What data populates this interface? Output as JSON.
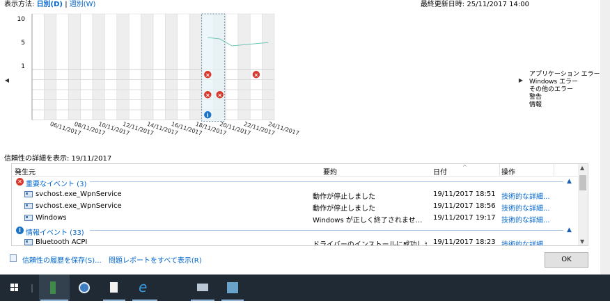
{
  "view": {
    "label": "表示方法:",
    "daily": "日別(D)",
    "sep": "|",
    "weekly": "週別(W)"
  },
  "last_updated": "最終更新日時: 25/11/2017 14:00",
  "chart": {
    "y_ticks": [
      "10",
      "5",
      "1"
    ],
    "dates": [
      "06/11/2017",
      "08/11/2017",
      "10/11/2017",
      "12/11/2017",
      "14/11/2017",
      "16/11/2017",
      "18/11/2017",
      "20/11/2017",
      "22/11/2017",
      "24/11/2017"
    ],
    "legend": [
      "アプリケーション エラー",
      "Windows エラー",
      "その他のエラー",
      "警告",
      "情報"
    ],
    "selected_day": "19/11/2017",
    "events": [
      {
        "day": "19/11/2017",
        "row": "アプリケーション エラー",
        "type": "error"
      },
      {
        "day": "23/11/2017",
        "row": "アプリケーション エラー",
        "type": "error"
      },
      {
        "day": "19/11/2017",
        "row": "その他のエラー",
        "type": "error"
      },
      {
        "day": "20/11/2017",
        "row": "その他のエラー",
        "type": "error"
      },
      {
        "day": "19/11/2017",
        "row": "情報",
        "type": "info"
      }
    ],
    "accent": "#6cc4b4"
  },
  "details": {
    "title": "信頼性の詳細を表示: 19/11/2017",
    "columns": {
      "source": "発生元",
      "summary": "要約",
      "date": "日付",
      "action": "操作"
    },
    "groups": [
      {
        "icon": "error",
        "label": "重要なイベント (3)",
        "rows": [
          {
            "source": "svchost.exe_WpnService",
            "summary": "動作が停止しました",
            "date": "19/11/2017 18:51",
            "action": "技術的な詳細..."
          },
          {
            "source": "svchost.exe_WpnService",
            "summary": "動作が停止しました",
            "date": "19/11/2017 18:56",
            "action": "技術的な詳細..."
          },
          {
            "source": "Windows",
            "summary": "Windows が正しく終了されませんでした",
            "date": "19/11/2017 19:17",
            "action": "技術的な詳細..."
          }
        ]
      },
      {
        "icon": "info",
        "label": "情報イベント (33)",
        "rows": [
          {
            "source": "Bluetooth ACPI",
            "summary": "ドライバーのインストールに成功しました",
            "date": "19/11/2017 18:23",
            "action": "技術的な詳細..."
          }
        ]
      }
    ]
  },
  "footer": {
    "save_history": "信頼性の履歴を保存(S)...",
    "show_reports": "問題レポートをすべて表示(R)",
    "ok": "OK"
  }
}
